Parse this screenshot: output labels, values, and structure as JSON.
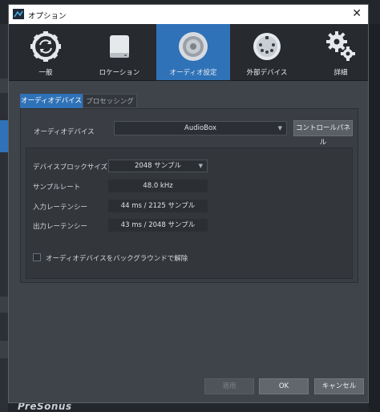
{
  "window": {
    "title": "オプション",
    "close_glyph": "✕"
  },
  "background": {
    "brand_text": "PreSonus"
  },
  "toolbar": {
    "items": [
      {
        "label": "一般",
        "icon": "sync-icon"
      },
      {
        "label": "ロケーション",
        "icon": "drive-icon"
      },
      {
        "label": "オーディオ設定",
        "icon": "speaker-icon",
        "active": true
      },
      {
        "label": "外部デバイス",
        "icon": "midi-connector-icon"
      },
      {
        "label": "詳細",
        "icon": "gears-icon"
      }
    ]
  },
  "tabs": [
    {
      "label": "オーディオデバイス",
      "active": true
    },
    {
      "label": "プロセッシング",
      "active": false
    }
  ],
  "audio": {
    "device_label": "オーディオデバイス",
    "device_value": "AudioBox",
    "control_panel_label": "コントロールパネル",
    "block_size_label": "デバイスブロックサイズ",
    "block_size_value": "2048 サンプル",
    "sample_rate_label": "サンプルレート",
    "sample_rate_value": "48.0 kHz",
    "input_latency_label": "入力レーテンシー",
    "input_latency_value": "44 ms / 2125 サンプル",
    "output_latency_label": "出力レーテンシー",
    "output_latency_value": "43 ms / 2048 サンプル",
    "background_checkbox_label": "オーディオデバイスをバックグラウンドで解除",
    "background_checkbox_checked": false
  },
  "footer": {
    "apply_label": "適用",
    "ok_label": "OK",
    "cancel_label": "キャンセル"
  },
  "colors": {
    "accent": "#2f72b8",
    "dialog_bg": "#3f444a",
    "toolbar_bg": "#272a2f"
  }
}
